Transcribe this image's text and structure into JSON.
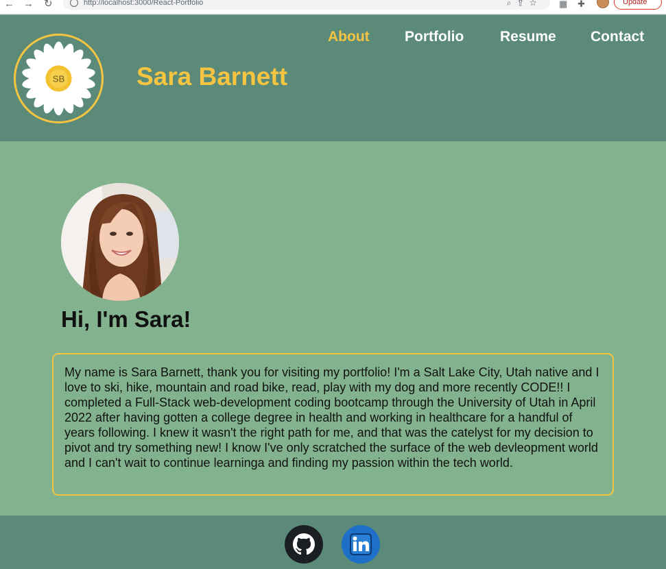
{
  "browser": {
    "url": "http://localhost:3000/React-Portfolio",
    "update_label": "Update"
  },
  "header": {
    "logo_initials": "SB",
    "title": "Sara Barnett",
    "nav": [
      {
        "label": "About",
        "active": true
      },
      {
        "label": "Portfolio",
        "active": false
      },
      {
        "label": "Resume",
        "active": false
      },
      {
        "label": "Contact",
        "active": false
      }
    ]
  },
  "main": {
    "greeting": "Hi, I'm Sara!",
    "bio": "My name is Sara Barnett, thank you for visiting my portfolio! I'm a Salt Lake City, Utah native and I love to ski, hike, mountain and road bike, read, play with my dog and more recently CODE!! I completed a Full-Stack web-development coding bootcamp through the University of Utah in April 2022 after having gotten a college degree in health and working in healthcare for a handful of years following. I knew it wasn't the right path for me, and that was the catelyst for my decision to pivot and try something new! I know I've only scratched the surface of the web devleopment world and I can't wait to continue learninga and finding my passion within the tech world."
  },
  "footer": {
    "links": [
      {
        "icon": "github-icon"
      },
      {
        "icon": "linkedin-icon"
      }
    ]
  },
  "colors": {
    "header_bg": "#5b8a78",
    "page_bg": "#83b38e",
    "accent": "#f5c542",
    "nav_text": "#ffffff"
  }
}
